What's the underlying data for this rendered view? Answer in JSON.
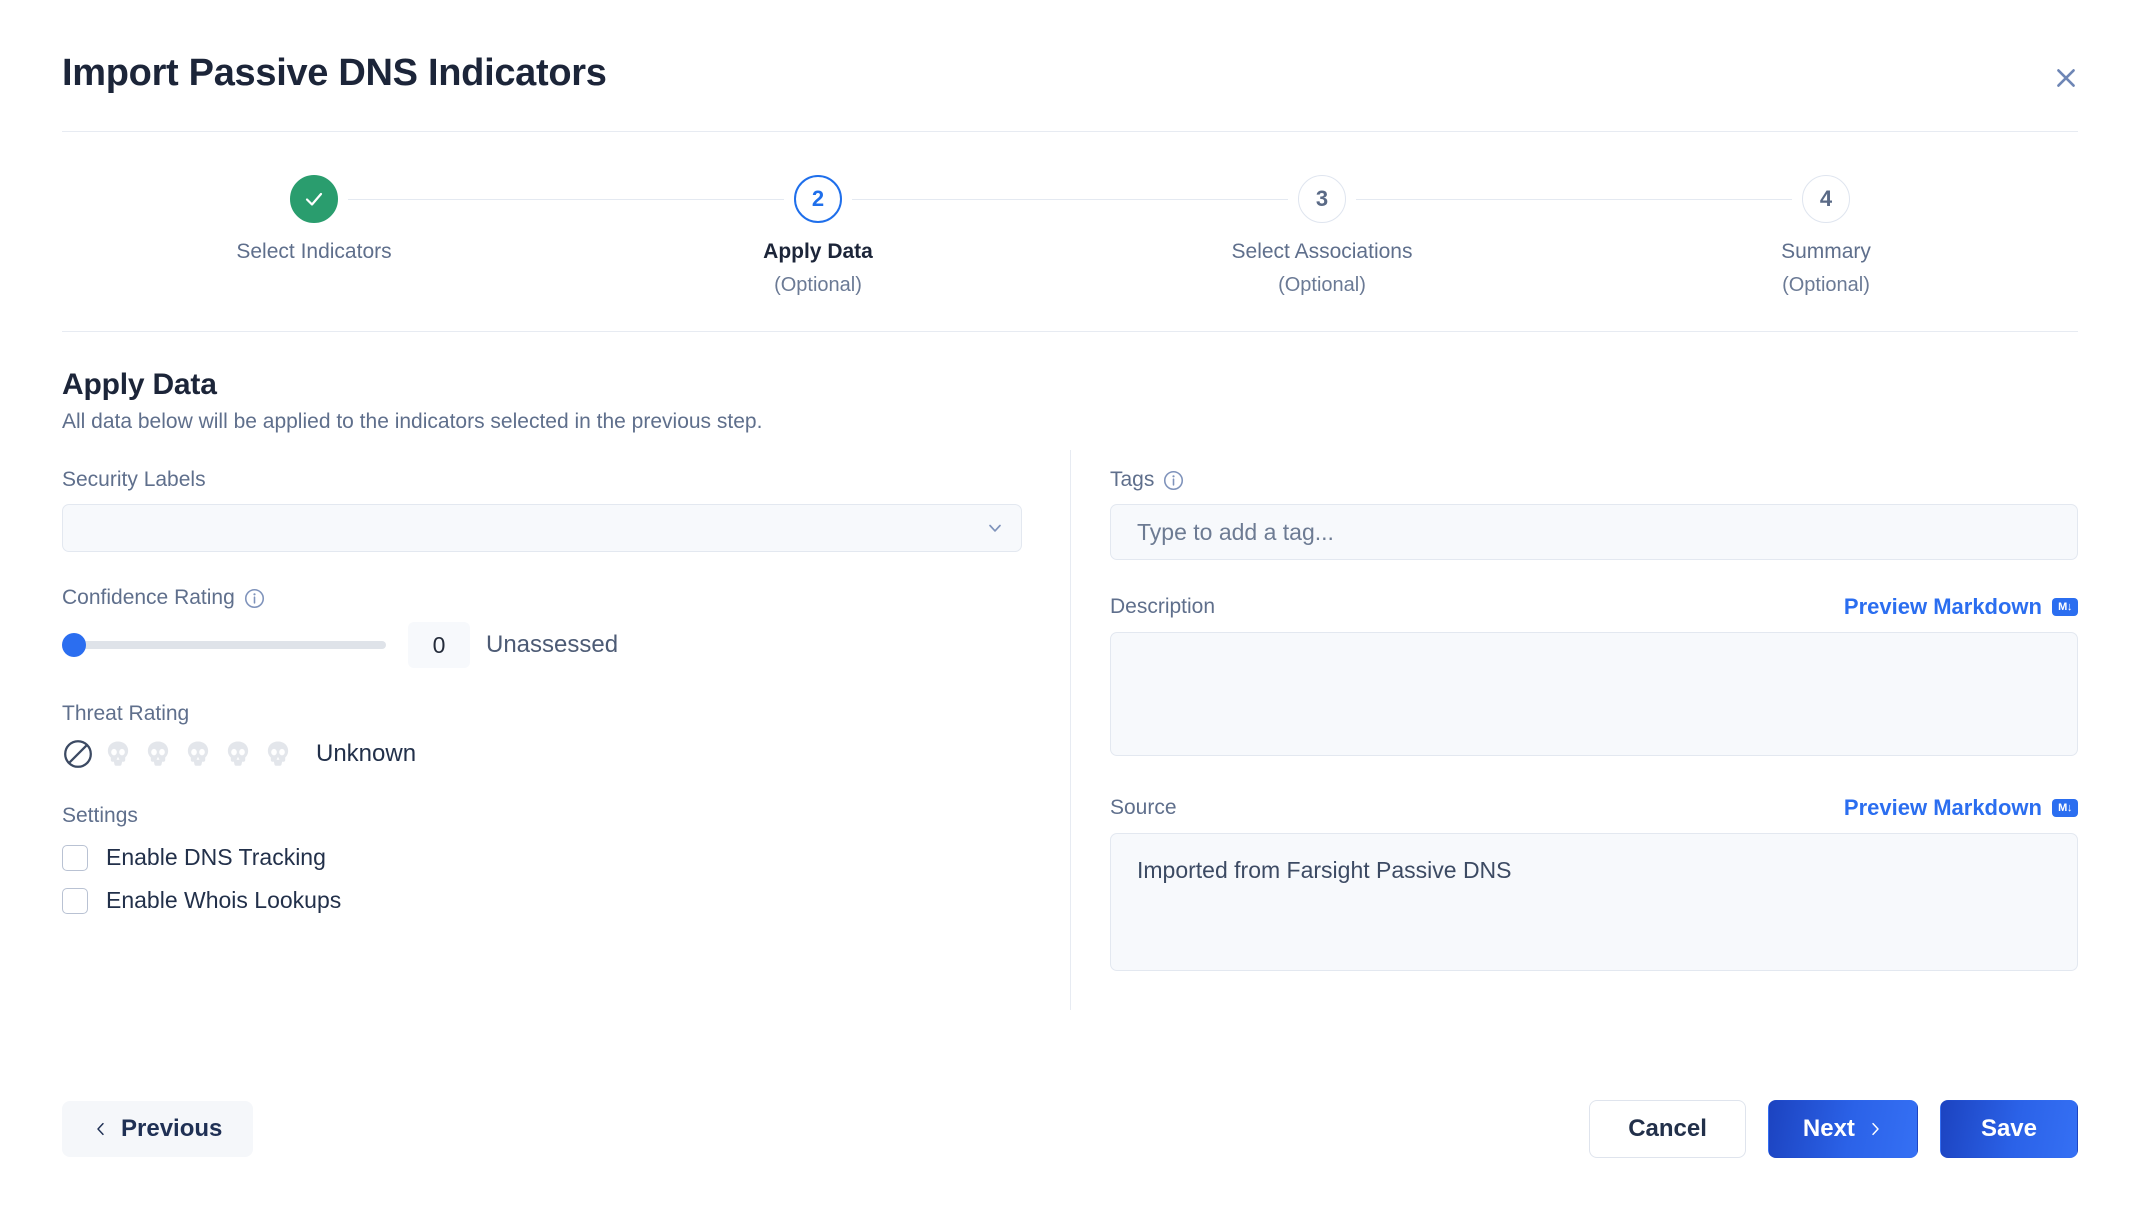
{
  "header": {
    "title": "Import Passive DNS Indicators",
    "close_icon": "close-icon"
  },
  "stepper": {
    "steps": [
      {
        "number": "1",
        "label": "Select Indicators",
        "sub": "",
        "state": "done",
        "icon": "check-icon"
      },
      {
        "number": "2",
        "label": "Apply Data",
        "sub": "(Optional)",
        "state": "current"
      },
      {
        "number": "3",
        "label": "Select Associations",
        "sub": "(Optional)",
        "state": "idle"
      },
      {
        "number": "4",
        "label": "Summary",
        "sub": "(Optional)",
        "state": "idle"
      }
    ]
  },
  "section": {
    "title": "Apply Data",
    "subtitle": "All data below will be applied to the indicators selected in the previous step."
  },
  "left": {
    "security_labels": {
      "label": "Security Labels",
      "value": "",
      "chevron_icon": "chevron-down-icon"
    },
    "confidence": {
      "label": "Confidence Rating",
      "info_icon": "info-icon",
      "value": "0",
      "status": "Unassessed",
      "min": 0,
      "max": 100
    },
    "threat": {
      "label": "Threat Rating",
      "value": "Unknown",
      "none_icon": "no-entry-icon",
      "skull_count": 5,
      "skulls_filled": 0
    },
    "settings": {
      "label": "Settings",
      "options": [
        {
          "label": "Enable DNS Tracking",
          "checked": false
        },
        {
          "label": "Enable Whois Lookups",
          "checked": false
        }
      ]
    }
  },
  "right": {
    "tags": {
      "label": "Tags",
      "info_icon": "info-icon",
      "placeholder": "Type to add a tag...",
      "value": ""
    },
    "description": {
      "label": "Description",
      "preview_label": "Preview Markdown",
      "markdown_icon": "markdown-icon",
      "value": ""
    },
    "source": {
      "label": "Source",
      "preview_label": "Preview Markdown",
      "markdown_icon": "markdown-icon",
      "value": "Imported from Farsight Passive DNS"
    }
  },
  "footer": {
    "previous": "Previous",
    "cancel": "Cancel",
    "next": "Next",
    "save": "Save",
    "prev_icon": "chevron-left-icon",
    "next_icon": "chevron-right-icon"
  },
  "colors": {
    "accent_blue": "#2b6ef0",
    "step_done_green": "#2a9d6e",
    "step_current_blue": "#1f6feb",
    "title_navy": "#1c2539",
    "label_grey": "#5f6f8c",
    "field_bg": "#f7f9fc",
    "border": "#e3e8f0"
  }
}
